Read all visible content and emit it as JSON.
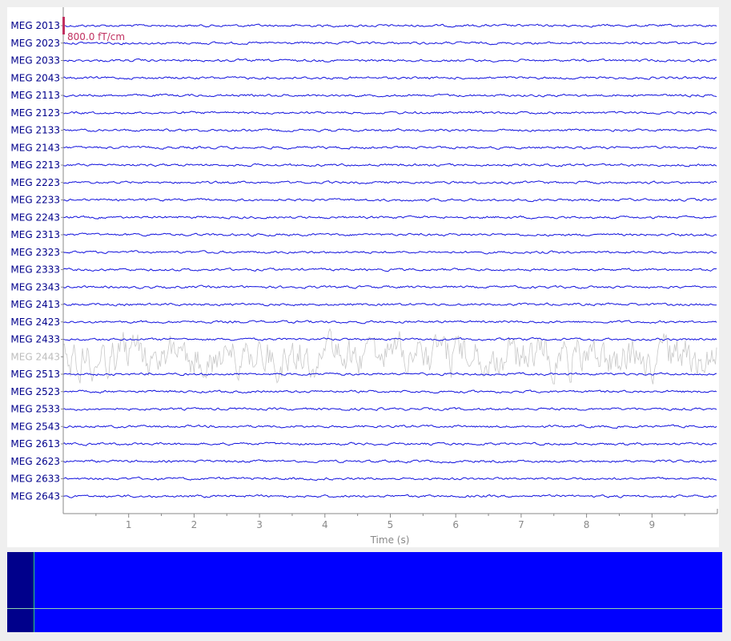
{
  "colors": {
    "trace": "#1111dd",
    "bad_trace": "#c8c8c8",
    "label": "#00008b",
    "bad_label": "#bdbdbd",
    "scale": "#c03060",
    "axis": "#888888",
    "overview_bg": "#0000ff",
    "overview_window": "#00008b",
    "overview_marker": "#2ecc71"
  },
  "scale_bar": {
    "label": "800.0 fT/cm"
  },
  "channels": [
    {
      "name": "MEG 2013",
      "bad": false
    },
    {
      "name": "MEG 2023",
      "bad": false
    },
    {
      "name": "MEG 2033",
      "bad": false
    },
    {
      "name": "MEG 2043",
      "bad": false
    },
    {
      "name": "MEG 2113",
      "bad": false
    },
    {
      "name": "MEG 2123",
      "bad": false
    },
    {
      "name": "MEG 2133",
      "bad": false
    },
    {
      "name": "MEG 2143",
      "bad": false
    },
    {
      "name": "MEG 2213",
      "bad": false
    },
    {
      "name": "MEG 2223",
      "bad": false
    },
    {
      "name": "MEG 2233",
      "bad": false
    },
    {
      "name": "MEG 2243",
      "bad": false
    },
    {
      "name": "MEG 2313",
      "bad": false
    },
    {
      "name": "MEG 2323",
      "bad": false
    },
    {
      "name": "MEG 2333",
      "bad": false
    },
    {
      "name": "MEG 2343",
      "bad": false
    },
    {
      "name": "MEG 2413",
      "bad": false
    },
    {
      "name": "MEG 2423",
      "bad": false
    },
    {
      "name": "MEG 2433",
      "bad": false
    },
    {
      "name": "MEG 2443",
      "bad": true
    },
    {
      "name": "MEG 2513",
      "bad": false
    },
    {
      "name": "MEG 2523",
      "bad": false
    },
    {
      "name": "MEG 2533",
      "bad": false
    },
    {
      "name": "MEG 2543",
      "bad": false
    },
    {
      "name": "MEG 2613",
      "bad": false
    },
    {
      "name": "MEG 2623",
      "bad": false
    },
    {
      "name": "MEG 2633",
      "bad": false
    },
    {
      "name": "MEG 2643",
      "bad": false
    }
  ],
  "time_axis": {
    "label": "Time (s)",
    "range": [
      0,
      10
    ],
    "ticks": [
      1,
      2,
      3,
      4,
      5,
      6,
      7,
      8,
      9
    ]
  },
  "overview": {
    "visible_fraction": 0.037
  }
}
